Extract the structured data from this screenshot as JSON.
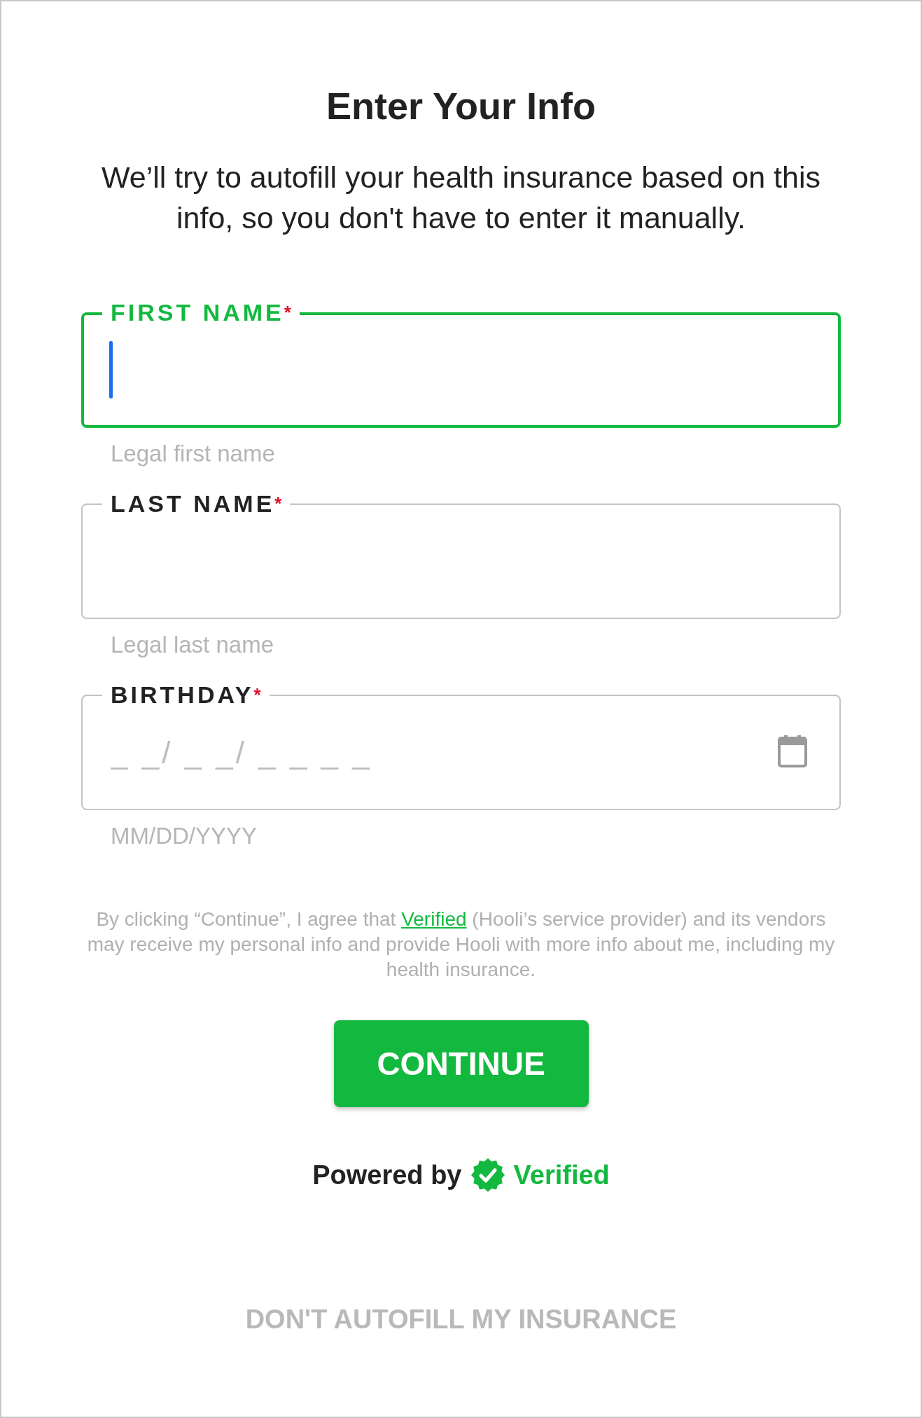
{
  "title": "Enter Your Info",
  "subtitle": "We’ll try to autofill your health insurance based on this info, so you don't have to enter it manually.",
  "fields": [
    {
      "kind": "text",
      "label": "FIRST NAME",
      "required_mark": "*",
      "focused": true,
      "helper": "Legal first name"
    },
    {
      "kind": "text",
      "label": "LAST NAME",
      "required_mark": "*",
      "focused": false,
      "helper": "Legal last name"
    },
    {
      "kind": "date",
      "label": "BIRTHDAY",
      "required_mark": "*",
      "focused": false,
      "placeholder": "_ _/ _ _/ _ _ _ _",
      "helper": "MM/DD/YYYY"
    }
  ],
  "disclaimer": {
    "before": "By clicking “Continue”, I agree that ",
    "link": "Verified",
    "after": " (Hooli’s service provider) and its vendors may receive my personal info and provide Hooli with more info about me, including my health insurance."
  },
  "continue_button": "CONTINUE",
  "powered_by": {
    "prefix": "Powered by",
    "brand": "Verified"
  },
  "skip_link": "DON'T AUTOFILL MY INSURANCE"
}
